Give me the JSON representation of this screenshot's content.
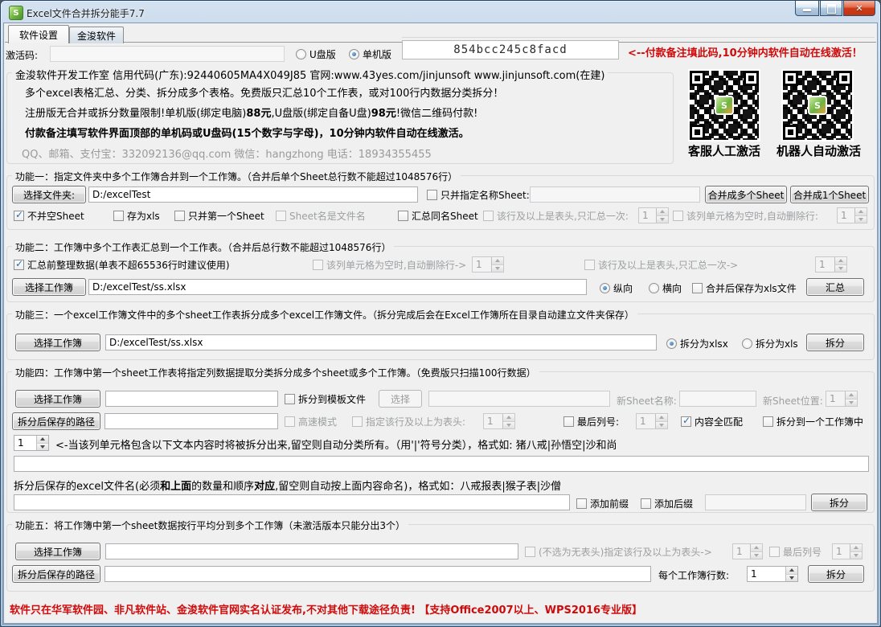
{
  "window": {
    "title": "Excel文件合并拆分能手7.7"
  },
  "tabs": {
    "settings": "软件设置",
    "about": "金浚软件"
  },
  "activation": {
    "label": "激活码:",
    "value": "",
    "usb": "U盘版",
    "standalone": "单机版",
    "machine_code": "854bcc245c8facd",
    "hint": "<--付款备注填此码,10分钟内软件自动在线激活！"
  },
  "info": {
    "title": "金浚软件开发工作室 信用代码(广东):92440605MA4X049J85 官网:www.43yes.com/jinjunsoft  www.jinjunsoft.com(在建)",
    "line1": "多个excel表格汇总、分类、拆分成多个表格。免费版只汇总10个工作表，或对100行内数据分类拆分！",
    "line2a": "注册版无合并或拆分数量限制!单机版(绑定电脑)",
    "line2b": "88元",
    "line2c": ",U盘版(绑定自备U盘)",
    "line2d": "98元",
    "line2e": "!微信二维码付款!",
    "line3": "付款备注填写软件界面顶部的单机码或U盘码(15个数字与字母)，10分钟内软件自动在线激活。",
    "line4": "QQ、邮箱、支付宝：332092136@qq.com  微信：hangzhong  电话：18934355455"
  },
  "qr": {
    "left_label": "客服人工激活",
    "right_label": "机器人自动激活"
  },
  "f1": {
    "title": "功能一：指定文件夹中多个工作簿合并到一个工作簿。（合并后单个Sheet总行数不能超过1048576行）",
    "select_folder": "选择文件夹:",
    "path": "D:/excelTest",
    "cb_named": "只并指定名称Sheet:",
    "named_value": "",
    "btn_multi": "合并成多个Sheet",
    "btn_single": "合并成1个Sheet",
    "cb_skip_empty": "不并空Sheet",
    "cb_save_xls": "存为xls",
    "cb_first_only": "只并第一个Sheet",
    "cb_sheet_name": "Sheet名是文件名",
    "cb_same_name": "汇总同名Sheet",
    "cb_header": "该行及以上是表头,只汇总一次:",
    "header_val": "1",
    "cb_del_row": "该列单元格为空时,自动删除行:",
    "del_row_val": "1"
  },
  "f2": {
    "title": "功能二：工作簿中多个工作表汇总到一个工作表。（合并后总行数不能超过1048576行）",
    "cb_clean": "汇总前整理数据(单表不超65536行时建议使用)",
    "cb_del_row": "该列单元格为空时,自动删除行->",
    "del_row_val": "1",
    "cb_header": "该行及以上是表头,只汇总一次->",
    "header_val": "1",
    "select_book": "选择工作簿",
    "path": "D:/excelTest/ss.xlsx",
    "radio_vertical": "纵向",
    "radio_horizontal": "横向",
    "cb_save_xls": "合并后保存为xls文件",
    "btn_merge": "汇总"
  },
  "f3": {
    "title": "功能三：一个excel工作簿文件中的多个sheet工作表拆分成多个excel工作簿文件。（拆分完成后会在Excel工作簿所在目录自动建立文件夹保存）",
    "select_book": "选择工作簿",
    "path": "D:/excelTest/ss.xlsx",
    "radio_xlsx": "拆分为xlsx",
    "radio_xls": "拆分为xls",
    "btn_split": "拆分"
  },
  "f4": {
    "title": "功能四：工作簿中第一个sheet工作表将指定列数据提取分类拆分成多个sheet或多个工作簿。（免费版只扫描100行数据）",
    "select_book": "选择工作簿",
    "path": "",
    "cb_template": "拆分到模板文件",
    "btn_choose": "选择",
    "template_path": "",
    "new_sheet_label": "新Sheet名称:",
    "new_sheet_value": "",
    "new_pos_label": "新Sheet位置:",
    "new_pos_val": "1",
    "save_path_btn": "拆分后保存的路径",
    "save_path": "",
    "cb_fast": "高速模式",
    "cb_header": "指定该行及以上为表头:",
    "header_val": "1",
    "cb_last_col": "最后列号:",
    "last_col_val": "1",
    "cb_match": "内容全匹配",
    "cb_one_book": "拆分到一个工作簿中",
    "col_val": "1",
    "hint1": "<-当该列单元格包含以下文本内容时将被拆分出来,留空则自动分类所有。（用'|'符号分类），格式如: 猪八戒|孙悟空|沙和尚",
    "filter_value": "",
    "hint2a": "拆分后保存的excel文件名(必须",
    "hint2b": "和上面",
    "hint2c": "的数量和顺序",
    "hint2d": "对应",
    "hint2e": ",留空则自动按上面内容命名)，格式如：八戒报表|猴子表|沙僧",
    "names_value": "",
    "cb_prefix": "添加前缀",
    "cb_suffix": "添加后缀",
    "fix_value": "",
    "btn_split": "拆分"
  },
  "f5": {
    "title": "功能五：将工作簿中第一个sheet数据按行平均分到多个工作簿（未激活版本只能分出3个）",
    "select_book": "选择工作簿",
    "path": "",
    "cb_header": "(不选为无表头)指定该行及以上为表头->",
    "header_val": "1",
    "cb_last_col": "最后列号",
    "last_col_val": "1",
    "save_path_btn": "拆分后保存的路径",
    "save_path": "",
    "rows_label": "每个工作簿行数:",
    "rows_val": "1",
    "btn_split": "拆分"
  },
  "footer": {
    "notice": "软件只在华军软件园、非凡软件站、金浚软件官网实名认证发布,不对其他下载途径负责! 【支持Office2007以上、WPS2016专业版】"
  }
}
